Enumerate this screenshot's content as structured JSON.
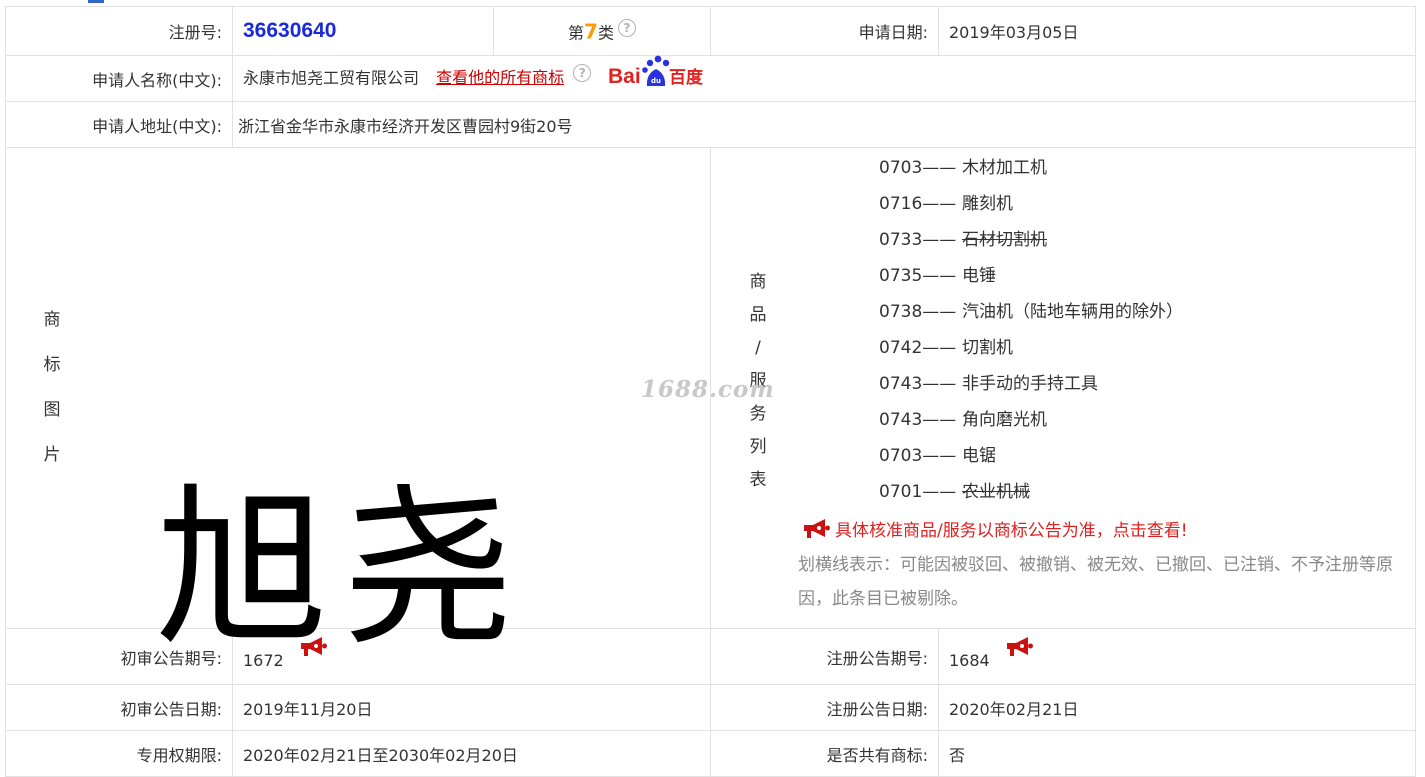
{
  "registration": {
    "number_label": "注册号:",
    "number": "36630640",
    "class_prefix": "第",
    "class_num": "7",
    "class_suffix": "类",
    "help_glyph": "?",
    "app_date_label": "申请日期:",
    "app_date": "2019年03月05日"
  },
  "applicant": {
    "name_label": "申请人名称(中文):",
    "name": "永康市旭尧工贸有限公司",
    "all_marks_link": "查看他的所有商标",
    "help_glyph": "?",
    "baidu_logo": "Bai百度",
    "address_label": "申请人地址(中文):",
    "address": "浙江省金华市永康市经济开发区曹园村9街20号"
  },
  "mark_image": {
    "label_chars": [
      "商",
      "标",
      "图",
      "片"
    ],
    "mark_text": "旭尧"
  },
  "goods": {
    "label_chars": [
      "商",
      "品",
      "/",
      "服",
      "务",
      "列",
      "表"
    ],
    "watermark": "1688.com",
    "items": [
      {
        "code": "0703——",
        "name": "木材加工机",
        "struck": false
      },
      {
        "code": "0716——",
        "name": "雕刻机",
        "struck": false
      },
      {
        "code": "0733——",
        "name": "石材切割机",
        "struck": true
      },
      {
        "code": "0735——",
        "name": "电锤",
        "struck": false
      },
      {
        "code": "0738——",
        "name": "汽油机（陆地车辆用的除外）",
        "struck": false
      },
      {
        "code": "0742——",
        "name": "切割机",
        "struck": false
      },
      {
        "code": "0743——",
        "name": "非手动的手持工具",
        "struck": false
      },
      {
        "code": "0743——",
        "name": "角向磨光机",
        "struck": false
      },
      {
        "code": "0703——",
        "name": "电锯",
        "struck": false
      },
      {
        "code": "0701——",
        "name": "农业机械",
        "struck": true
      }
    ],
    "notice": "具体核准商品/服务以商标公告为准，点击查看!",
    "strike_note": "划横线表示：可能因被驳回、被撤销、被无效、已撤回、已注销、不予注册等原因，此条目已被剔除。"
  },
  "publication": {
    "prelim_no_label": "初审公告期号:",
    "prelim_no": "1672",
    "reg_no_label": "注册公告期号:",
    "reg_no": "1684",
    "prelim_date_label": "初审公告日期:",
    "prelim_date": "2019年11月20日",
    "reg_date_label": "注册公告日期:",
    "reg_date": "2020年02月21日",
    "period_label": "专用权期限:",
    "period": "2020年02月21日至2030年02月20日",
    "shared_label": "是否共有商标:",
    "shared": "否"
  },
  "colors": {
    "reg_number": "#1a2ad8",
    "class_number": "#ff9900",
    "link": "#cc0000",
    "notice": "#e02020",
    "horn": "#cc1111",
    "border": "#e2e2e2"
  },
  "icons": {
    "help": "question-circle-icon",
    "horn": "megaphone-icon",
    "baidu": "baidu-logo-icon"
  }
}
